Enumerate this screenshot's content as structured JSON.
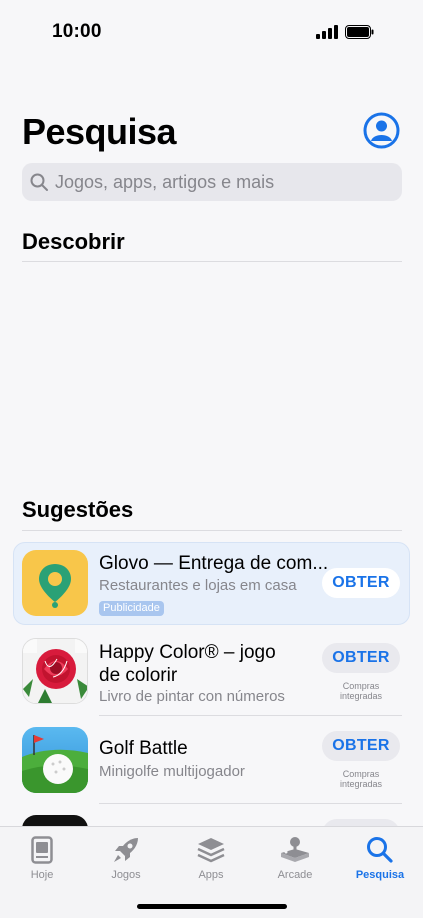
{
  "status": {
    "time": "10:00"
  },
  "header": {
    "title": "Pesquisa"
  },
  "search": {
    "placeholder": "Jogos, apps, artigos e mais"
  },
  "sections": {
    "discover": "Descobrir",
    "suggestions": "Sugestões"
  },
  "apps": [
    {
      "name": "Glovo — Entrega de com...",
      "subtitle": "Restaurantes e lojas em casa",
      "badge": "Publicidade",
      "button": "OBTER"
    },
    {
      "name_line1": "Happy Color® – jogo",
      "name_line2": "de colorir",
      "subtitle": "Livro de pintar con números",
      "button": "OBTER",
      "iap_line1": "Compras",
      "iap_line2": "integradas"
    },
    {
      "name": "Golf Battle",
      "subtitle": "Minigolfe multijogador",
      "button": "OBTER",
      "iap_line1": "Compras",
      "iap_line2": "integradas"
    }
  ],
  "tabs": [
    {
      "label": "Hoje",
      "icon": "today-icon"
    },
    {
      "label": "Jogos",
      "icon": "rocket-icon"
    },
    {
      "label": "Apps",
      "icon": "layers-icon"
    },
    {
      "label": "Arcade",
      "icon": "joystick-icon"
    },
    {
      "label": "Pesquisa",
      "icon": "search-icon",
      "active": true
    }
  ],
  "colors": {
    "accent": "#1a73e8",
    "glovo_bg": "#f8c64a",
    "glovo_pin": "#2aa176"
  }
}
